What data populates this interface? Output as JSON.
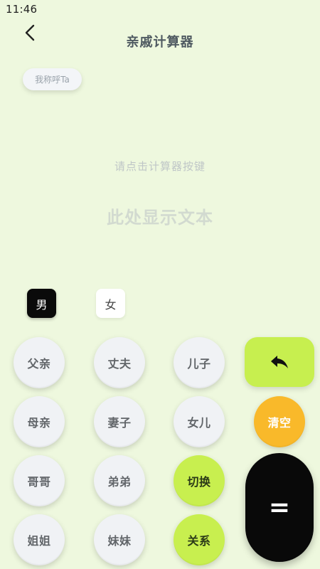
{
  "status_bar": {
    "time": "11:46"
  },
  "header": {
    "title": "亲戚计算器"
  },
  "tag_button": {
    "label": "我称呼Ta"
  },
  "display": {
    "hint": "请点击计算器按键",
    "text": "此处显示文本"
  },
  "gender": {
    "male": "男",
    "female": "女",
    "selected": "男"
  },
  "keys": {
    "father": "父亲",
    "husband": "丈夫",
    "son": "儿子",
    "mother": "母亲",
    "wife": "妻子",
    "daughter": "女儿",
    "clear": "清空",
    "elder_brother": "哥哥",
    "younger_brother": "弟弟",
    "switch": "切换",
    "elder_sister": "姐姐",
    "younger_sister": "妹妹",
    "relation": "关系",
    "equals": "="
  },
  "icons": {
    "back": "chevron-left-icon",
    "backspace": "reply-arrow-icon"
  },
  "colors": {
    "background": "#eef8de",
    "accent_green": "#c8ef4f",
    "accent_orange": "#f9b92a",
    "key_gray": "#f0f2f5",
    "black": "#090909"
  }
}
